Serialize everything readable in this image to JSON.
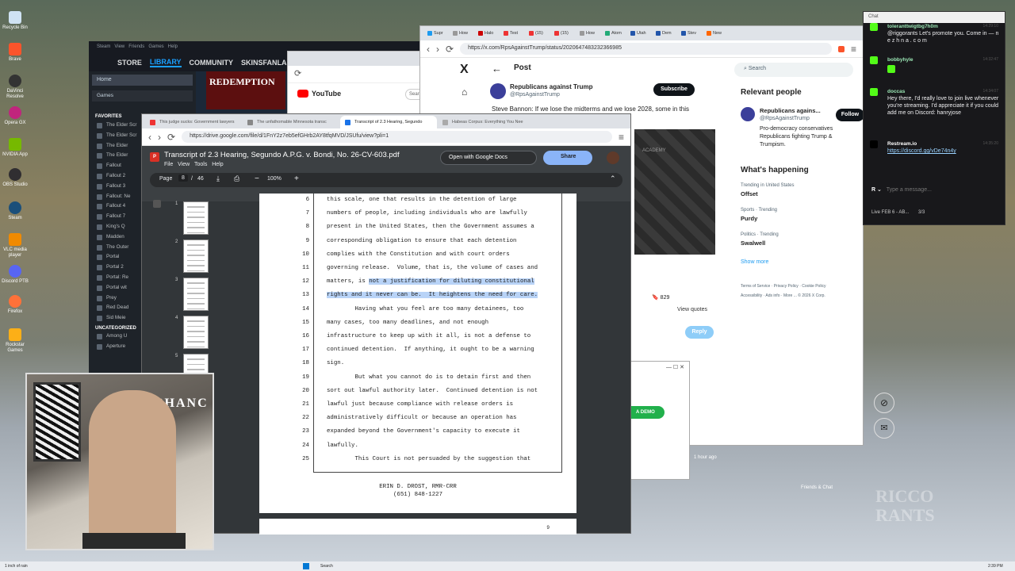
{
  "desktop": {
    "icons": [
      "Recycle Bin",
      "Brave",
      "DaVinci Resolve",
      "Opera GX",
      "NVIDIA App",
      "OBS Studio",
      "Steam",
      "VLC media player",
      "Discord PTB",
      "Firefox",
      "Rockstar Games"
    ]
  },
  "steam": {
    "menu": [
      "Steam",
      "View",
      "Friends",
      "Games",
      "Help"
    ],
    "nav": [
      "STORE",
      "LIBRARY",
      "COMMUNITY",
      "SKINSFANLA"
    ],
    "home": "Home",
    "games": "Games",
    "favorites": "FAVORITES",
    "favorite_items": [
      "The Elder Scr",
      "The Elder Scr",
      "The Elder",
      "The Elder",
      "Fallout",
      "Fallout 2",
      "Fallout 3",
      "Fallout: Ne",
      "Fallout 4",
      "Fallout 7",
      "King's Q",
      "Madden",
      "The Outer",
      "Portal",
      "Portal 2",
      "Portal: Re",
      "Portal wit",
      "Prey",
      "Red Dead",
      "Sid Meie"
    ],
    "uncategorized": "UNCATEGORIZED",
    "uncat_items": [
      "Among U",
      "Aperture"
    ],
    "banner": "REDEMPTION"
  },
  "yt": {
    "title": "YouTube",
    "search": "Sear"
  },
  "xwin": {
    "url": "https://x.com/RpsAgainstTrump/status/2020647483232366985",
    "tabs": [
      "Supr",
      "How",
      "Halo",
      "Test",
      "(15)",
      "(15)",
      "How",
      "Atom",
      "Utah",
      "Dem",
      "Stev",
      "New"
    ],
    "post_header": "Post",
    "author": "Republicans against Trump",
    "handle": "@RpsAgainstTrump",
    "subscribe": "Subscribe",
    "tweet": "Steve Bannon: If we lose the midterms and we lose 2028, some in this",
    "search_placeholder": "Search",
    "relevant_header": "Relevant people",
    "relevant_name": "Republicans agains...",
    "relevant_handle": "@RpsAgainstTrump",
    "follow": "Follow",
    "relevant_bio": "Pro-democracy conservatives Republicans fighting Trump & Trumpism.",
    "happening": "What's happening",
    "trends": [
      {
        "cat": "Trending in United States",
        "name": "Offset"
      },
      {
        "cat": "Sports · Trending",
        "name": "Purdy"
      },
      {
        "cat": "Politics · Trending",
        "name": "Swalwell"
      }
    ],
    "show_more": "Show more",
    "footer_links": [
      "Terms of Service",
      "Privacy Policy",
      "Cookie Policy",
      "Accessibility",
      "Ads info",
      "More ...",
      "© 2026 X Corp."
    ],
    "bookmarks": "829",
    "view_quotes": "View quotes",
    "reply": "Reply",
    "academy": "ACADEMY",
    "demo": "A DEMO",
    "time_ago": "1 hour ago",
    "friends_chat": "Friends & Chat"
  },
  "chat": {
    "title": "Chat",
    "messages": [
      {
        "user": "toleranttwigtbg7h0m",
        "time": "14:29:10",
        "text": "@riggorants Let's promote you. Come in — n e z h n a . c o m"
      },
      {
        "user": "bobbyhyle",
        "time": "14:32:47",
        "text": ""
      },
      {
        "user": "doccas",
        "time": "14:34:07",
        "text": "Hey there, I'd really love to join live whenever you're streaming. I'd appreciate it if you could add me on Discord: hanryjose"
      },
      {
        "user": "Restream.io",
        "time": "14:35:20",
        "text": "https://discord.gg/vDe74n4y"
      }
    ],
    "input_placeholder": "Type a message...",
    "live": "Live FEB 6 - AB...",
    "viewers": "3/3"
  },
  "pdf": {
    "tabs": [
      "This judge sucks: Government lawyers",
      "The unfathomable Minnesota transc",
      "Transcript of 2.3 Hearing, Segundo",
      "Habeas Corpus: Everything You Nee"
    ],
    "url": "https://drive.google.com/file/d/1FnY2z7eb5efGHrb2AY8tfqMVD/JSUfu/view?pli=1",
    "title": "Transcript of 2.3 Hearing, Segundo A.P.G. v. Bondi, No. 26-CV-603.pdf",
    "menu": [
      "File",
      "View",
      "Tools",
      "Help"
    ],
    "open_with": "Open with Google Docs",
    "share": "Share",
    "page_label": "Page",
    "page_current": "8",
    "page_total": "46",
    "zoom": "100%",
    "thumb_nums": [
      "1",
      "2",
      "3",
      "4",
      "5"
    ],
    "lines": [
      {
        "n": "6",
        "pre": "this scale, one that results in the detention of large",
        "hl": "",
        "post": ""
      },
      {
        "n": "7",
        "pre": "numbers of people, including individuals who are lawfully",
        "hl": "",
        "post": ""
      },
      {
        "n": "8",
        "pre": "present in the United States, then the Government assumes a",
        "hl": "",
        "post": ""
      },
      {
        "n": "9",
        "pre": "corresponding obligation to ensure that each detention",
        "hl": "",
        "post": ""
      },
      {
        "n": "10",
        "pre": "complies with the Constitution and with court orders",
        "hl": "",
        "post": ""
      },
      {
        "n": "11",
        "pre": "governing release.  Volume, that is, the volume of cases and",
        "hl": "",
        "post": ""
      },
      {
        "n": "12",
        "pre": "matters, is ",
        "hl": "not a justification for diluting constitutional",
        "post": ""
      },
      {
        "n": "13",
        "pre": "",
        "hl": "rights and it never can be.  It heightens the need for care.",
        "post": ""
      },
      {
        "n": "14",
        "pre": "        Having what you feel are too many detainees, too",
        "hl": "",
        "post": ""
      },
      {
        "n": "15",
        "pre": "many cases, too many deadlines, and not enough",
        "hl": "",
        "post": ""
      },
      {
        "n": "16",
        "pre": "infrastructure to keep up with it all, is not a defense to",
        "hl": "",
        "post": ""
      },
      {
        "n": "17",
        "pre": "continued detention.  If anything, it ought to be a warning",
        "hl": "",
        "post": ""
      },
      {
        "n": "18",
        "pre": "sign.",
        "hl": "",
        "post": ""
      },
      {
        "n": "19",
        "pre": "        But what you cannot do is to detain first and then",
        "hl": "",
        "post": ""
      },
      {
        "n": "20",
        "pre": "sort out lawful authority later.  Continued detention is not",
        "hl": "",
        "post": ""
      },
      {
        "n": "21",
        "pre": "lawful just because compliance with release orders is",
        "hl": "",
        "post": ""
      },
      {
        "n": "22",
        "pre": "administratively difficult or because an operation has",
        "hl": "",
        "post": ""
      },
      {
        "n": "23",
        "pre": "expanded beyond the Government's capacity to execute it",
        "hl": "",
        "post": ""
      },
      {
        "n": "24",
        "pre": "lawfully.",
        "hl": "",
        "post": ""
      },
      {
        "n": "25",
        "pre": "        This Court is not persuaded by the suggestion that",
        "hl": "",
        "post": ""
      }
    ],
    "reporter": "ERIN D. DROST, RMR-CRR",
    "phone": "(651) 848-1227",
    "next_page_num": "9"
  },
  "cam": {
    "sign": "CHANC"
  },
  "taskbar": {
    "weather": "1 inch of rain",
    "search": "Search",
    "time": "2:39 PM"
  },
  "watermark": "RICCO RANTS"
}
